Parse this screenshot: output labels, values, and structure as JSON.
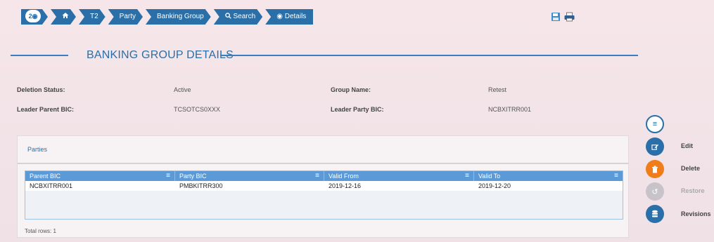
{
  "breadcrumb": {
    "badge": "2",
    "items": [
      "T2",
      "Party",
      "Banking Group",
      "Search",
      "Details"
    ]
  },
  "page_title": "BANKING GROUP DETAILS",
  "details": {
    "deletion_status_label": "Deletion Status:",
    "deletion_status_value": "Active",
    "group_name_label": "Group Name:",
    "group_name_value": "Retest",
    "leader_parent_bic_label": "Leader Parent BIC:",
    "leader_parent_bic_value": "TCSOTCS0XXX",
    "leader_party_bic_label": "Leader Party BIC:",
    "leader_party_bic_value": "NCBXITRR001"
  },
  "parties": {
    "tab_label": "Parties",
    "columns": [
      "Parent BIC",
      "Party BIC",
      "Valid From",
      "Valid To"
    ],
    "rows": [
      [
        "NCBXITRR001",
        "PMBKITRR300",
        "2019-12-16",
        "2019-12-20"
      ]
    ],
    "total_rows": "Total rows: 1"
  },
  "actions": {
    "edit": "Edit",
    "delete": "Delete",
    "restore": "Restore",
    "revisions": "Revisions"
  },
  "colors": {
    "primary": "#2a6fa8",
    "grid_header": "#5b9ad6",
    "delete": "#f07d1a",
    "disabled": "#c8c3c8"
  }
}
